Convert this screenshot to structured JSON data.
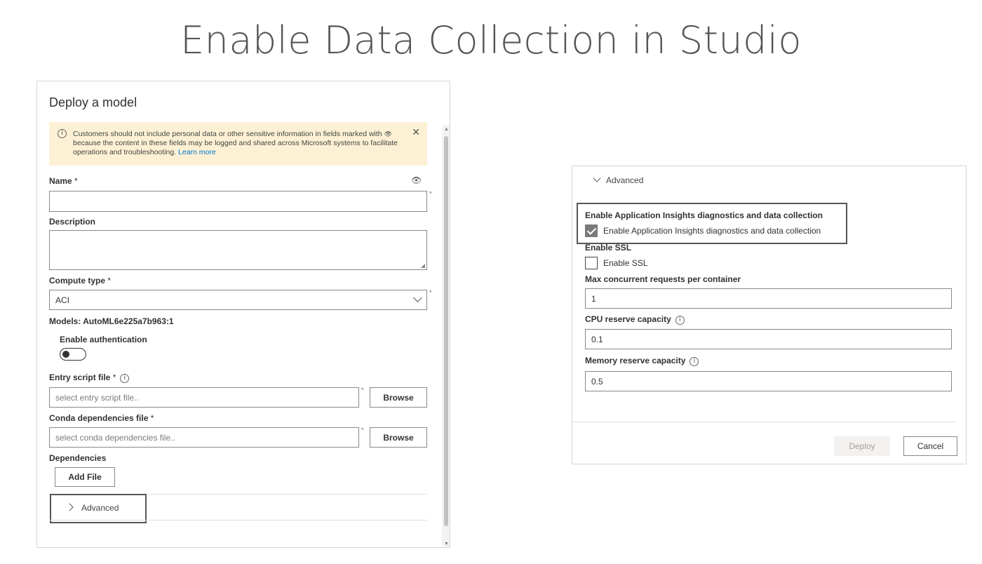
{
  "slide": {
    "title": "Enable Data Collection in Studio"
  },
  "deploy_panel": {
    "title": "Deploy a model",
    "notice": {
      "text_before": "Customers should not include personal data or other sensitive information in fields marked with ",
      "eye_glyph": "👁",
      "text_after": " because the content in these fields may be logged and shared across Microsoft systems to facilitate operations and troubleshooting.",
      "learn_more": "Learn more",
      "close": "✕"
    },
    "name": {
      "label": "Name",
      "required": "*",
      "value": ""
    },
    "description": {
      "label": "Description",
      "value": ""
    },
    "compute_type": {
      "label": "Compute type",
      "required": "*",
      "value": "ACI"
    },
    "models_text": "Models: AutoML6e225a7b963:1",
    "enable_auth": {
      "label": "Enable authentication",
      "state": "off"
    },
    "entry_script": {
      "label": "Entry script file",
      "required": "*",
      "placeholder": "select entry script file..",
      "browse": "Browse"
    },
    "conda": {
      "label": "Conda dependencies file",
      "required": "*",
      "placeholder": "select conda dependencies file..",
      "browse": "Browse"
    },
    "dependencies": {
      "label": "Dependencies",
      "add_file": "Add File"
    },
    "advanced_label": "Advanced",
    "side_star": "*"
  },
  "advanced_panel": {
    "header": "Advanced",
    "app_insights": {
      "heading": "Enable Application Insights diagnostics and data collection",
      "checkbox_label": "Enable Application Insights diagnostics and data collection",
      "checked": true
    },
    "ssl": {
      "heading": "Enable SSL",
      "checkbox_label": "Enable SSL",
      "checked": false
    },
    "max_requests": {
      "label": "Max concurrent requests per container",
      "value": "1"
    },
    "cpu": {
      "label": "CPU reserve capacity",
      "value": "0.1"
    },
    "memory": {
      "label": "Memory reserve capacity",
      "value": "0.5"
    },
    "deploy_button": "Deploy",
    "cancel_button": "Cancel"
  }
}
